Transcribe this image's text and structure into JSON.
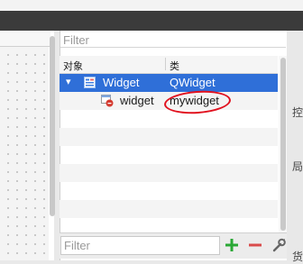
{
  "filter_top": {
    "placeholder": "Filter"
  },
  "tree": {
    "headers": {
      "object": "对象",
      "class": "类"
    },
    "root": {
      "name": "Widget",
      "class": "QWidget"
    },
    "child": {
      "name": "widget",
      "class": "mywidget"
    }
  },
  "filter_bottom": {
    "placeholder": "Filter"
  },
  "right_edge": {
    "text1": "控",
    "text2": "局",
    "text3": "货"
  },
  "colors": {
    "selection": "#2f6fd8",
    "annotation": "#e1101e",
    "add_icon": "#2aa836",
    "remove_icon": "#d94b4b"
  },
  "icons": {
    "expand": "chevron-down-icon",
    "form": "form-widget-icon",
    "widget": "widget-icon",
    "add": "plus-icon",
    "remove": "minus-icon",
    "configure": "wrench-icon"
  }
}
